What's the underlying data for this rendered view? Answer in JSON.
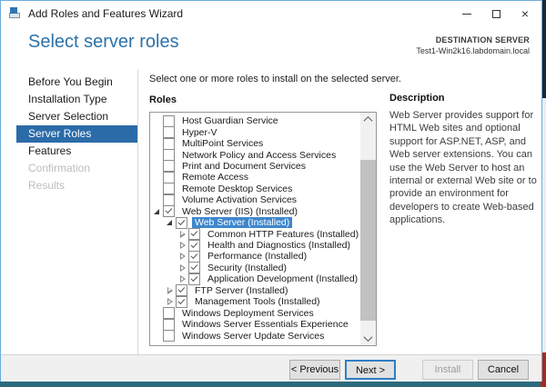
{
  "window": {
    "title": "Add Roles and Features Wizard",
    "icons": {
      "close": "×"
    }
  },
  "header": {
    "page_title": "Select server roles",
    "destination_label": "DESTINATION SERVER",
    "destination_server": "Test1-Win2k16.labdomain.local"
  },
  "sidebar": {
    "items": [
      {
        "label": "Before You Begin",
        "state": "normal"
      },
      {
        "label": "Installation Type",
        "state": "normal"
      },
      {
        "label": "Server Selection",
        "state": "normal"
      },
      {
        "label": "Server Roles",
        "state": "active"
      },
      {
        "label": "Features",
        "state": "normal"
      },
      {
        "label": "Confirmation",
        "state": "disabled"
      },
      {
        "label": "Results",
        "state": "disabled"
      }
    ]
  },
  "main": {
    "intro": "Select one or more roles to install on the selected server.",
    "roles_label": "Roles",
    "roles": [
      {
        "label": "Host Guardian Service",
        "state": "unchecked",
        "indent": 0,
        "arrow": "none"
      },
      {
        "label": "Hyper-V",
        "state": "unchecked",
        "indent": 0,
        "arrow": "none"
      },
      {
        "label": "MultiPoint Services",
        "state": "unchecked",
        "indent": 0,
        "arrow": "none"
      },
      {
        "label": "Network Policy and Access Services",
        "state": "unchecked",
        "indent": 0,
        "arrow": "none"
      },
      {
        "label": "Print and Document Services",
        "state": "unchecked",
        "indent": 0,
        "arrow": "none"
      },
      {
        "label": "Remote Access",
        "state": "unchecked",
        "indent": 0,
        "arrow": "none"
      },
      {
        "label": "Remote Desktop Services",
        "state": "unchecked",
        "indent": 0,
        "arrow": "none"
      },
      {
        "label": "Volume Activation Services",
        "state": "unchecked",
        "indent": 0,
        "arrow": "none"
      },
      {
        "label": "Web Server (IIS) (Installed)",
        "state": "checked",
        "indent": 0,
        "arrow": "expanded"
      },
      {
        "label": "Web Server (Installed)",
        "state": "checked-selected",
        "indent": 1,
        "arrow": "expanded"
      },
      {
        "label": "Common HTTP Features (Installed)",
        "state": "checked",
        "indent": 2,
        "arrow": "collapsed"
      },
      {
        "label": "Health and Diagnostics (Installed)",
        "state": "checked",
        "indent": 2,
        "arrow": "collapsed"
      },
      {
        "label": "Performance (Installed)",
        "state": "checked",
        "indent": 2,
        "arrow": "collapsed"
      },
      {
        "label": "Security (Installed)",
        "state": "checked",
        "indent": 2,
        "arrow": "collapsed"
      },
      {
        "label": "Application Development (Installed)",
        "state": "checked",
        "indent": 2,
        "arrow": "collapsed"
      },
      {
        "label": "FTP Server (Installed)",
        "state": "checked",
        "indent": 1,
        "arrow": "collapsed"
      },
      {
        "label": "Management Tools (Installed)",
        "state": "checked",
        "indent": 1,
        "arrow": "collapsed"
      },
      {
        "label": "Windows Deployment Services",
        "state": "unchecked",
        "indent": 0,
        "arrow": "none"
      },
      {
        "label": "Windows Server Essentials Experience",
        "state": "unchecked",
        "indent": 0,
        "arrow": "none"
      },
      {
        "label": "Windows Server Update Services",
        "state": "unchecked",
        "indent": 0,
        "arrow": "none"
      }
    ]
  },
  "description": {
    "title": "Description",
    "body": "Web Server provides support for HTML Web sites and optional support for ASP.NET, ASP, and Web server extensions. You can use the Web Server to host an internal or external Web site or to provide an environment for developers to create Web-based applications."
  },
  "footer": {
    "buttons": [
      {
        "label": "< Previous",
        "state": "normal"
      },
      {
        "label": "Next >",
        "state": "focused"
      },
      {
        "label": "Install",
        "state": "disabled"
      },
      {
        "label": "Cancel",
        "state": "normal"
      }
    ]
  },
  "colors": {
    "title_blue": "#2d72a9",
    "sidebar_selection_blue": "#2b6ba8",
    "tree_selection_blue": "#3e87cd",
    "window_border_blue": "#6badde",
    "focus_border_blue": "#2f7fc2",
    "taskbar_teal": "#2d6a7c",
    "desktop_red": "#a8281f",
    "desktop_navy": "#1c2733"
  }
}
